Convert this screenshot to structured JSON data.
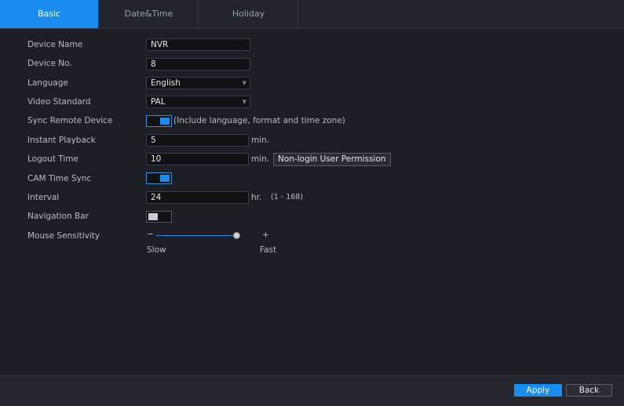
{
  "tabs": [
    {
      "label": "Basic"
    },
    {
      "label": "Date&Time"
    },
    {
      "label": "Holiday"
    }
  ],
  "form": {
    "device_name": {
      "label": "Device Name",
      "value": "NVR"
    },
    "device_no": {
      "label": "Device No.",
      "value": "8"
    },
    "language": {
      "label": "Language",
      "value": "English"
    },
    "video_standard": {
      "label": "Video Standard",
      "value": "PAL"
    },
    "sync_remote": {
      "label": "Sync Remote Device",
      "enabled": true,
      "note": "(Include language, format and time zone)"
    },
    "instant_playback": {
      "label": "Instant Playback",
      "value": "5",
      "unit": "min."
    },
    "logout_time": {
      "label": "Logout Time",
      "value": "10",
      "unit": "min.",
      "permission_button": "Non-login User Permission"
    },
    "cam_time_sync": {
      "label": "CAM Time Sync",
      "enabled": true
    },
    "interval": {
      "label": "Interval",
      "value": "24",
      "unit": "hr.",
      "range": "(1 - 168)"
    },
    "navigation_bar": {
      "label": "Navigation Bar",
      "enabled": false
    },
    "mouse_sensitivity": {
      "label": "Mouse Sensitivity",
      "minus": "−",
      "plus": "+",
      "slow": "Slow",
      "fast": "Fast",
      "level": 1.0
    }
  },
  "footer": {
    "apply": "Apply",
    "back": "Back"
  },
  "colors": {
    "accent": "#1a8cf0",
    "background": "#1e1f26"
  }
}
